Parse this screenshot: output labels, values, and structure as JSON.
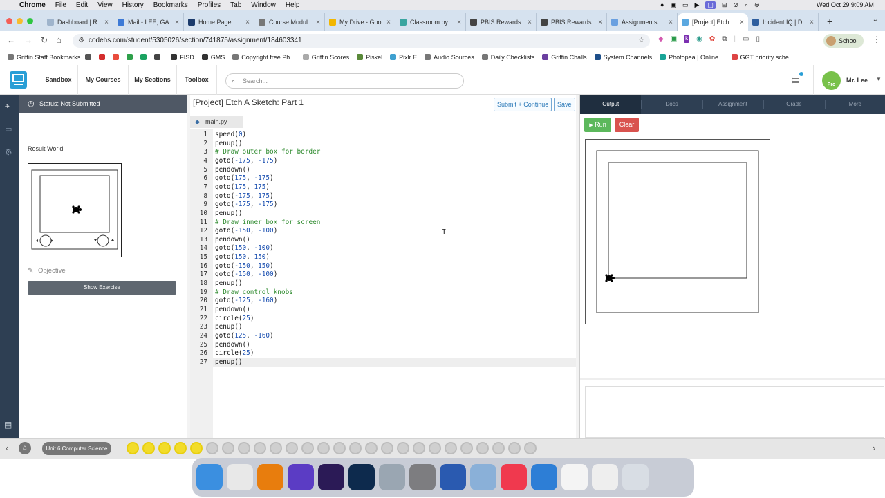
{
  "menubar": {
    "app": "Chrome",
    "items": [
      "File",
      "Edit",
      "View",
      "History",
      "Bookmarks",
      "Profiles",
      "Tab",
      "Window",
      "Help"
    ],
    "clock": "Wed Oct 29  9:09 AM"
  },
  "tabs": [
    {
      "title": "Dashboard | R",
      "color": "#9fb4cc"
    },
    {
      "title": "Mail - LEE, GA",
      "color": "#3d7ad6"
    },
    {
      "title": "Home Page",
      "color": "#1b3a6b"
    },
    {
      "title": "Course Modul",
      "color": "#777777"
    },
    {
      "title": "My Drive - Goo",
      "color": "#f2b600"
    },
    {
      "title": "Classroom by",
      "color": "#3aa5a0"
    },
    {
      "title": "PBIS Rewards",
      "color": "#444444"
    },
    {
      "title": "PBIS Rewards",
      "color": "#444444"
    },
    {
      "title": "Assignments",
      "color": "#6aa0e0"
    },
    {
      "title": "[Project] Etch",
      "color": "#5ba8e0"
    },
    {
      "title": "Incident IQ | D",
      "color": "#2e5e9e"
    }
  ],
  "address": {
    "url": "codehs.com/student/5305026/section/741875/assignment/184603341",
    "profile": "School"
  },
  "bookmarks": [
    {
      "label": "Griffin Staff Bookmarks",
      "color": "#777777"
    },
    {
      "label": "",
      "color": "#555555"
    },
    {
      "label": "",
      "color": "#d42d2d"
    },
    {
      "label": "",
      "color": "#e94c3d"
    },
    {
      "label": "",
      "color": "#2ea04a"
    },
    {
      "label": "",
      "color": "#1aa260"
    },
    {
      "label": "",
      "color": "#444444"
    },
    {
      "label": "FISD",
      "color": "#333333"
    },
    {
      "label": "GMS",
      "color": "#333333"
    },
    {
      "label": "Copyright free Ph...",
      "color": "#777777"
    },
    {
      "label": "Griffin Scores",
      "color": "#aaaaaa"
    },
    {
      "label": "Piskel",
      "color": "#5a8a3a"
    },
    {
      "label": "Pixlr E",
      "color": "#3fa0d0"
    },
    {
      "label": "Audio Sources",
      "color": "#777777"
    },
    {
      "label": "Daily Checklists",
      "color": "#777777"
    },
    {
      "label": "Griffin Challs",
      "color": "#6b3fa0"
    },
    {
      "label": "System Channels",
      "color": "#1d4f8a"
    },
    {
      "label": "Photopea | Online...",
      "color": "#18a497"
    },
    {
      "label": "GGT priority sche...",
      "color": "#d44"
    }
  ],
  "nav": {
    "links": [
      "Sandbox",
      "My Courses",
      "My Sections",
      "Toolbox"
    ],
    "search_placeholder": "Search...",
    "user": "Mr. Lee",
    "pro_badge": "Pro"
  },
  "left": {
    "status": "Status: Not Submitted",
    "result_world": "Result World",
    "objective": "Objective",
    "show_exercise": "Show Exercise"
  },
  "editor": {
    "title": "[Project] Etch A Sketch: Part 1",
    "submit": "Submit + Continue",
    "save": "Save",
    "file": "main.py",
    "lines": [
      "speed(0)",
      "penup()",
      "# Draw outer box for border",
      "goto(-175, -175)",
      "pendown()",
      "goto(175, -175)",
      "goto(175, 175)",
      "goto(-175, 175)",
      "goto(-175, -175)",
      "penup()",
      "# Draw inner box for screen",
      "goto(-150, -100)",
      "pendown()",
      "goto(150, -100)",
      "goto(150, 150)",
      "goto(-150, 150)",
      "goto(-150, -100)",
      "penup()",
      "# Draw control knobs",
      "goto(-125, -160)",
      "pendown()",
      "circle(25)",
      "penup()",
      "goto(125, -160)",
      "pendown()",
      "circle(25)",
      "penup()"
    ]
  },
  "right": {
    "tabs": [
      "Output",
      "Docs",
      "Assignment",
      "Grade",
      "More"
    ],
    "run": "Run",
    "clear": "Clear"
  },
  "taskbar": {
    "unit": "Unit 6 Computer Science"
  },
  "dock": [
    {
      "name": "finder",
      "color": "#3b8fe0"
    },
    {
      "name": "chrome",
      "color": "#e8e8e8"
    },
    {
      "name": "blender",
      "color": "#e87d0d"
    },
    {
      "name": "imovie",
      "color": "#5b3cc4"
    },
    {
      "name": "premiere",
      "color": "#2b1a56"
    },
    {
      "name": "photoshop",
      "color": "#0d2a4d"
    },
    {
      "name": "quicktime",
      "color": "#9aa6b2"
    },
    {
      "name": "system-settings",
      "color": "#7d7d80"
    },
    {
      "name": "word",
      "color": "#2a5ab0"
    },
    {
      "name": "preview",
      "color": "#8ab0d8"
    },
    {
      "name": "music",
      "color": "#f0394e"
    },
    {
      "name": "globe",
      "color": "#2d7ed6"
    },
    {
      "name": "document",
      "color": "#f4f4f4"
    },
    {
      "name": "document2",
      "color": "#eeeeee"
    },
    {
      "name": "trash",
      "color": "#d8dde4"
    }
  ]
}
